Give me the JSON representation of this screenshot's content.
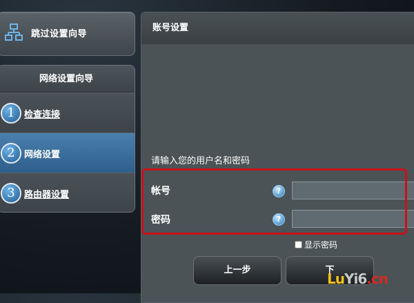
{
  "sidebar": {
    "skip_label": "跳过设置向导",
    "wizard_title": "网络设置向导",
    "steps": [
      {
        "num": "1",
        "label": "检查连接"
      },
      {
        "num": "2",
        "label": "网络设置",
        "active": true
      },
      {
        "num": "3",
        "label": "路由器设置"
      }
    ]
  },
  "main": {
    "title": "账号设置",
    "prompt": "请输入您的用户名和密码",
    "account_label": "帐号",
    "password_label": "密码",
    "account_value": "",
    "password_value": "",
    "help_glyph": "?",
    "show_password_label": "显示密码",
    "show_password_checked": false
  },
  "buttons": {
    "prev": "上一步",
    "next": "下"
  },
  "watermark": {
    "left": "Lu",
    "mid": "Yi6",
    "right": ".cn"
  },
  "colors": {
    "accent": "#2f5f8b",
    "highlight": "#c8121b"
  }
}
